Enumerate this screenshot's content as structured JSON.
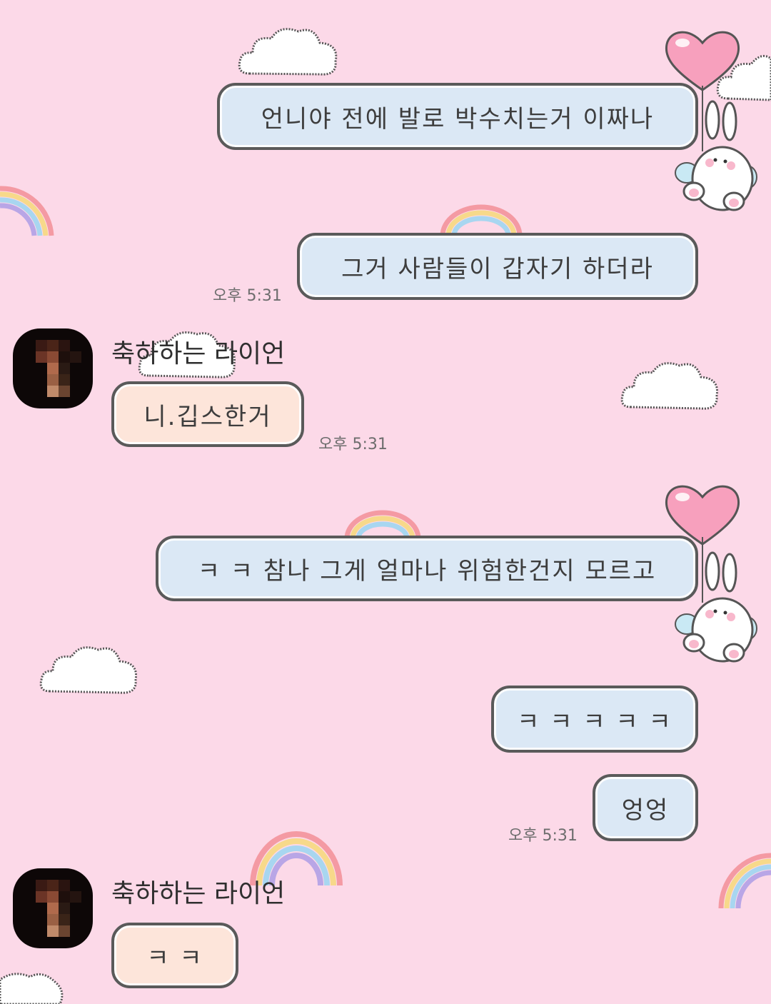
{
  "chat": {
    "messages": [
      {
        "text": "언니야 전에 발로 박수치는거 이짜나"
      },
      {
        "text": "그거 사람들이 갑자기 하더라",
        "time": "오후 5:31"
      },
      {
        "sender": "축하하는 라이언",
        "text": "니.깁스한거",
        "time": "오후 5:31"
      },
      {
        "text": "ㅋ ㅋ 참나 그게 얼마나 위험한건지 모르고"
      },
      {
        "text": "ㅋ ㅋ ㅋ ㅋ ㅋ"
      },
      {
        "text": "엉엉",
        "time": "오후 5:31"
      },
      {
        "sender": "축하하는 라이언",
        "text": "ㅋ ㅋ"
      }
    ]
  },
  "theme": {
    "background": "#fcd9e8",
    "outgoing_bubble": "#dbe8f5",
    "incoming_bubble": "#fde5da",
    "bubble_border": "#5a5a5a"
  }
}
